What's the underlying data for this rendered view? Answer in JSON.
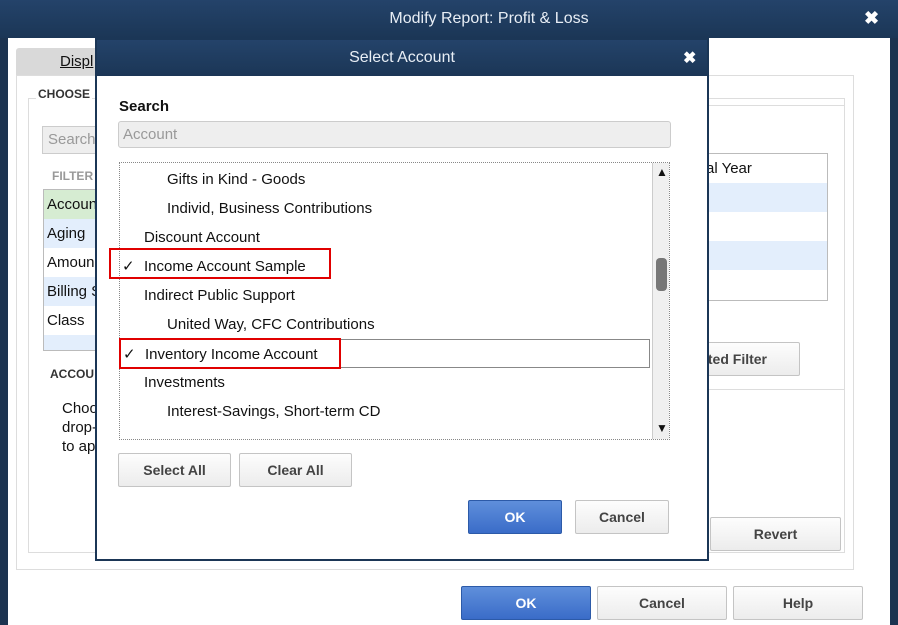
{
  "outer_dialog": {
    "title": "Modify Report: Profit & Loss",
    "tab_display": "Displ",
    "choose_label": "CHOOSE",
    "search_placeholder": "Search",
    "filter_label": "FILTER",
    "filters": [
      "Accoun",
      "Aging",
      "Amoun",
      "Billing S",
      "Class"
    ],
    "account_section_label": "ACCOU",
    "account_help_lines": [
      "Choo",
      "drop-",
      "to ap"
    ],
    "right_list_item": "scal Year",
    "filter_button": "ted Filter",
    "revert": "Revert",
    "ok": "OK",
    "cancel": "Cancel",
    "help": "Help"
  },
  "select_account": {
    "title": "Select Account",
    "search_label": "Search",
    "search_placeholder": "Account",
    "check_glyph": "✓",
    "accounts": [
      {
        "name": "Gifts in Kind - Goods",
        "level": 1,
        "checked": false
      },
      {
        "name": "Individ, Business Contributions",
        "level": 1,
        "checked": false
      },
      {
        "name": "Discount Account",
        "level": 0,
        "checked": false
      },
      {
        "name": "Income Account Sample",
        "level": 0,
        "checked": true
      },
      {
        "name": "Indirect Public Support",
        "level": 0,
        "checked": false
      },
      {
        "name": "United Way, CFC Contributions",
        "level": 1,
        "checked": false
      },
      {
        "name": "Inventory Income Account",
        "level": 0,
        "checked": true
      },
      {
        "name": "Investments",
        "level": 0,
        "checked": false
      },
      {
        "name": "Interest-Savings, Short-term CD",
        "level": 1,
        "checked": false
      }
    ],
    "select_all": "Select All",
    "clear_all": "Clear All",
    "ok": "OK",
    "cancel": "Cancel"
  },
  "colors": {
    "highlight_red": "#e00000",
    "primary_button": "#3a6cc8",
    "title_bar": "#1f3a5a",
    "selected_filter": "#d6ecd2"
  }
}
